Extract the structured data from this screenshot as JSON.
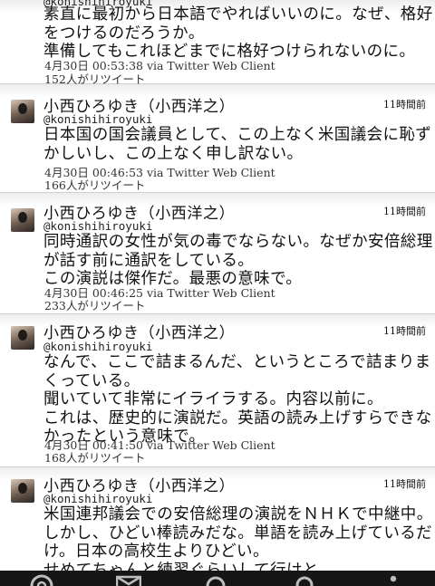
{
  "tweets": [
    {
      "handle": "@konishihiroyuki",
      "lines": [
        "素直に最初から日本語でやればいいのに。なぜ、格好",
        "をつけるのだろうか。",
        "準備してもこれほどまでに格好つけられないのに。"
      ],
      "meta": "4月30日 00:53:38 via Twitter Web Client",
      "retweets": "152人がリツイート"
    },
    {
      "name": "小西ひろゆき（小西洋之）",
      "handle": "@konishihiroyuki",
      "ago": "11時間前",
      "lines": [
        "日本国の国会議員として、この上なく米国議会に恥ず",
        "かしいし、この上なく申し訳ない。"
      ],
      "meta": "4月30日 00:46:53 via Twitter Web Client",
      "retweets": "166人がリツイート"
    },
    {
      "name": "小西ひろゆき（小西洋之）",
      "handle": "@konishihiroyuki",
      "ago": "11時間前",
      "lines": [
        "同時通訳の女性が気の毒でならない。なぜか安倍総理",
        "が話す前に通訳をしている。",
        "この演説は傑作だ。最悪の意味で。"
      ],
      "meta": "4月30日 00:46:25 via Twitter Web Client",
      "retweets": "233人がリツイート"
    },
    {
      "name": "小西ひろゆき（小西洋之）",
      "handle": "@konishihiroyuki",
      "ago": "11時間前",
      "lines": [
        "なんで、ここで詰まるんだ、というところで詰まりま",
        "くっている。",
        "聞いていて非常にイライラする。内容以前に。",
        "これは、歴史的に演説だ。英語の読み上げすらできな",
        "かったという意味で。"
      ],
      "meta": "4月30日 00:41:50 via Twitter Web Client",
      "retweets": "168人がリツイート"
    },
    {
      "name": "小西ひろゆき（小西洋之）",
      "handle": "@konishihiroyuki",
      "ago": "11時間前",
      "lines": [
        "米国連邦議会での安倍総理の演説をＮＨＫで中継中。",
        "しかし、ひどい棒読みだな。単語を読み上げているだ",
        "け。日本の高校生よりひどい。",
        "せめてちゃんと練習ぐらいして行けと。"
      ]
    }
  ],
  "bottom_nav": {
    "icons": [
      "at-icon",
      "mail-icon",
      "search-icon",
      "profile-icon",
      "more-icon"
    ]
  }
}
